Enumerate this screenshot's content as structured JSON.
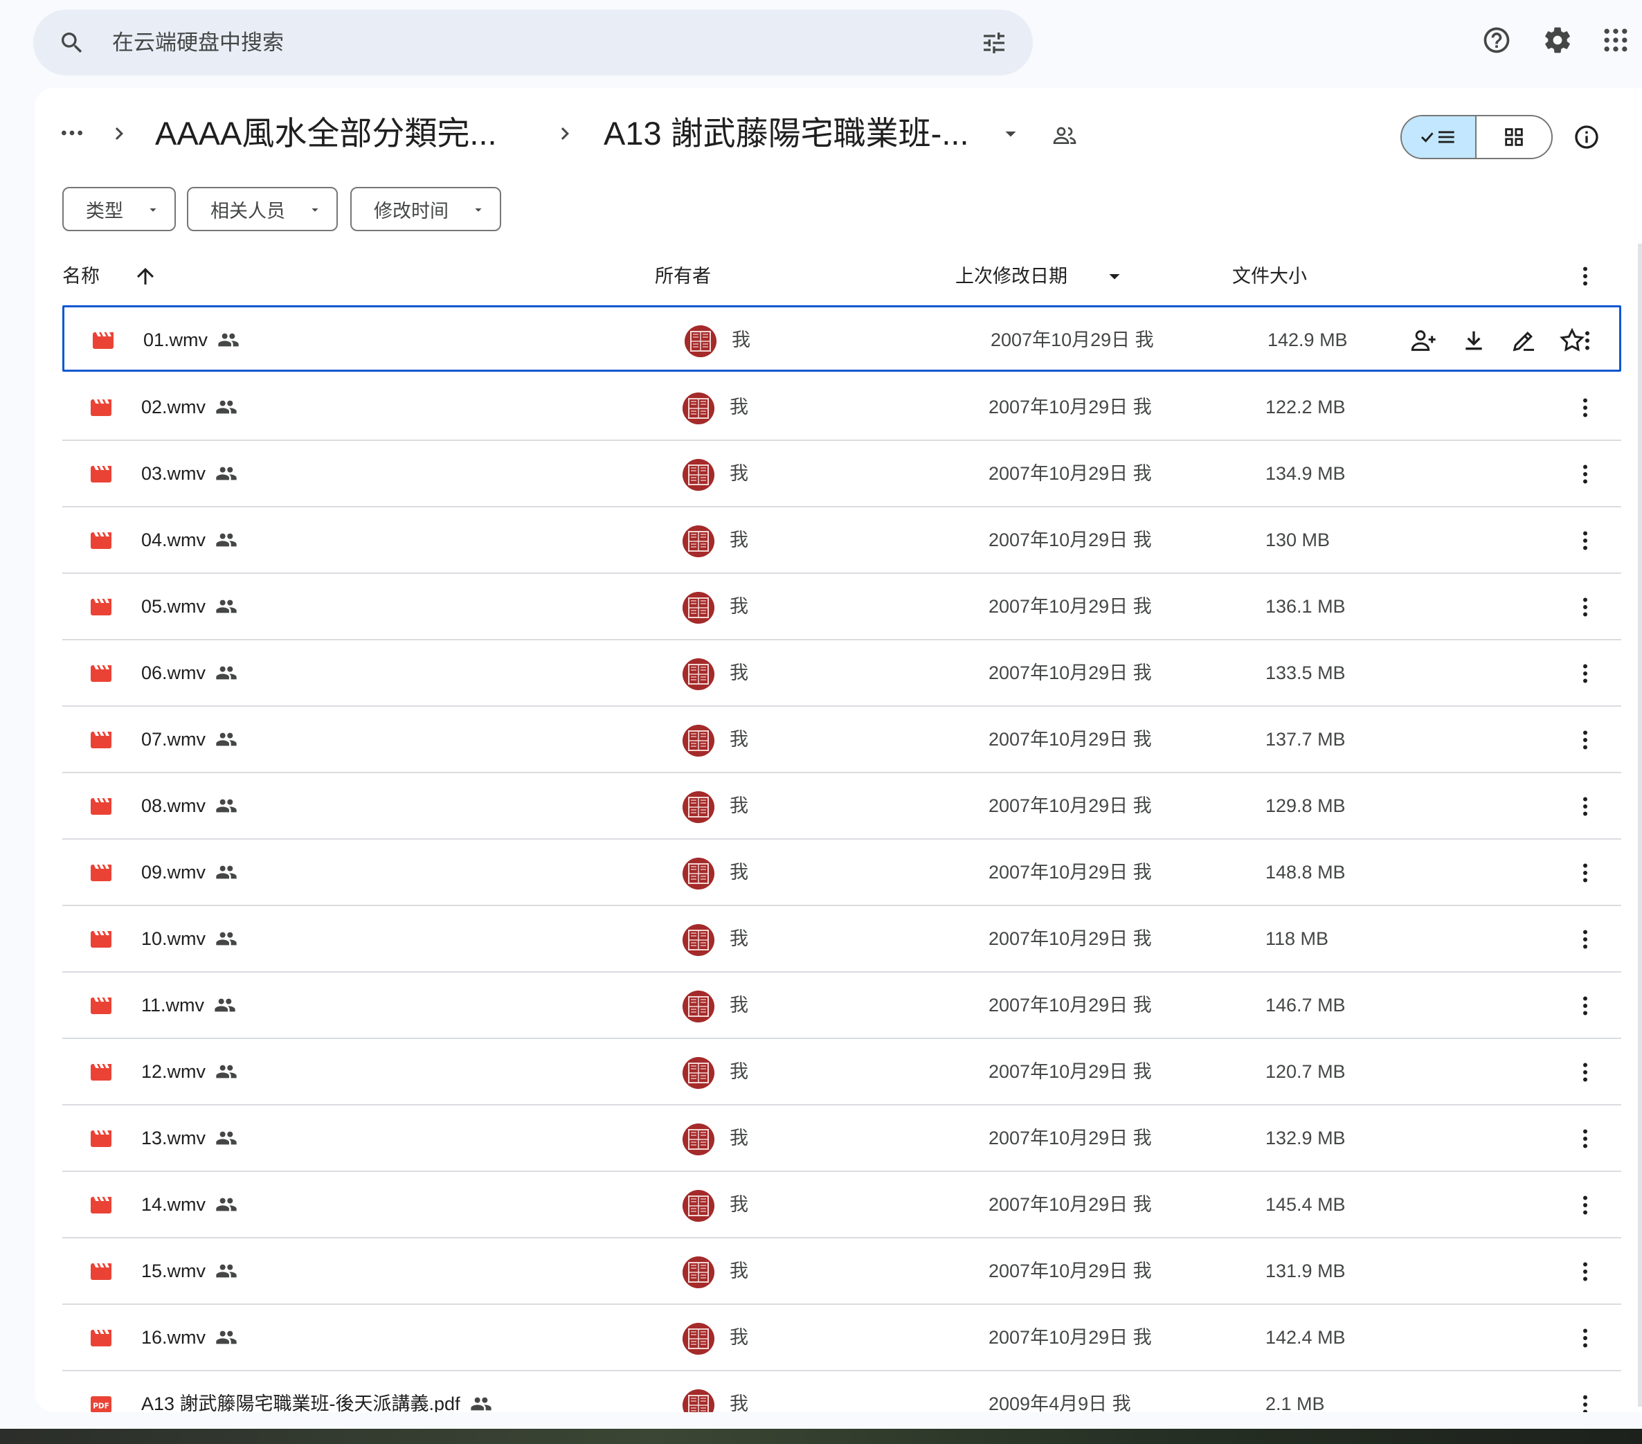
{
  "search": {
    "placeholder": "在云端硬盘中搜索"
  },
  "breadcrumb": {
    "items": [
      {
        "label": "AAAA風水全部分類完..."
      },
      {
        "label": "A13 謝武藤陽宅職業班-..."
      }
    ]
  },
  "filters": [
    {
      "label": "类型"
    },
    {
      "label": "相关人员"
    },
    {
      "label": "修改时间"
    }
  ],
  "columns": {
    "name": "名称",
    "owner": "所有者",
    "modified": "上次修改日期",
    "size": "文件大小"
  },
  "files": [
    {
      "name": "01.wmv",
      "type": "video",
      "owner": "我",
      "modified": "2007年10月29日 我",
      "size": "142.9 MB"
    },
    {
      "name": "02.wmv",
      "type": "video",
      "owner": "我",
      "modified": "2007年10月29日 我",
      "size": "122.2 MB"
    },
    {
      "name": "03.wmv",
      "type": "video",
      "owner": "我",
      "modified": "2007年10月29日 我",
      "size": "134.9 MB"
    },
    {
      "name": "04.wmv",
      "type": "video",
      "owner": "我",
      "modified": "2007年10月29日 我",
      "size": "130 MB"
    },
    {
      "name": "05.wmv",
      "type": "video",
      "owner": "我",
      "modified": "2007年10月29日 我",
      "size": "136.1 MB"
    },
    {
      "name": "06.wmv",
      "type": "video",
      "owner": "我",
      "modified": "2007年10月29日 我",
      "size": "133.5 MB"
    },
    {
      "name": "07.wmv",
      "type": "video",
      "owner": "我",
      "modified": "2007年10月29日 我",
      "size": "137.7 MB"
    },
    {
      "name": "08.wmv",
      "type": "video",
      "owner": "我",
      "modified": "2007年10月29日 我",
      "size": "129.8 MB"
    },
    {
      "name": "09.wmv",
      "type": "video",
      "owner": "我",
      "modified": "2007年10月29日 我",
      "size": "148.8 MB"
    },
    {
      "name": "10.wmv",
      "type": "video",
      "owner": "我",
      "modified": "2007年10月29日 我",
      "size": "118 MB"
    },
    {
      "name": "11.wmv",
      "type": "video",
      "owner": "我",
      "modified": "2007年10月29日 我",
      "size": "146.7 MB"
    },
    {
      "name": "12.wmv",
      "type": "video",
      "owner": "我",
      "modified": "2007年10月29日 我",
      "size": "120.7 MB"
    },
    {
      "name": "13.wmv",
      "type": "video",
      "owner": "我",
      "modified": "2007年10月29日 我",
      "size": "132.9 MB"
    },
    {
      "name": "14.wmv",
      "type": "video",
      "owner": "我",
      "modified": "2007年10月29日 我",
      "size": "145.4 MB"
    },
    {
      "name": "15.wmv",
      "type": "video",
      "owner": "我",
      "modified": "2007年10月29日 我",
      "size": "131.9 MB"
    },
    {
      "name": "16.wmv",
      "type": "video",
      "owner": "我",
      "modified": "2007年10月29日 我",
      "size": "142.4 MB"
    },
    {
      "name": "A13 謝武籐陽宅職業班-後天派講義.pdf",
      "type": "pdf",
      "owner": "我",
      "modified": "2009年4月9日 我",
      "size": "2.1 MB"
    }
  ],
  "selected_file": "01.wmv",
  "icons": {
    "search": "search-icon",
    "tune": "tune-icon",
    "help": "help-icon",
    "settings": "gear-icon",
    "apps": "apps-grid-icon",
    "video": "video-file-icon",
    "pdf": "pdf-file-icon",
    "shared": "shared-people-icon"
  },
  "colors": {
    "accent": "#0b57d0",
    "toggle_active": "#c2e7ff",
    "video_icon": "#ea4335",
    "avatar": "#a52a2a"
  }
}
